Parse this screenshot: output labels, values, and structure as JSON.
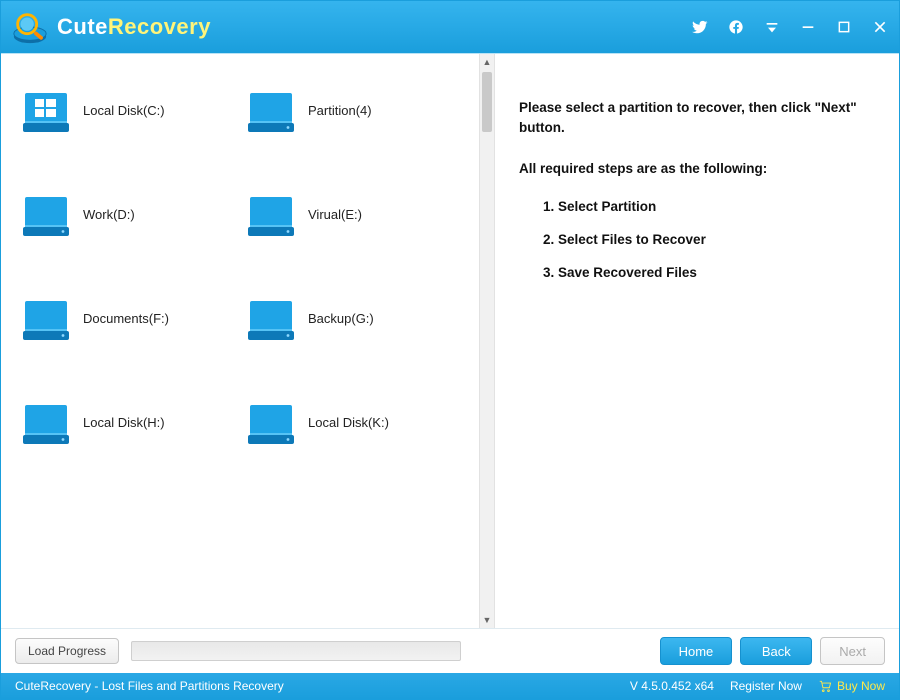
{
  "app": {
    "name_prefix": "Cute",
    "name_suffix": "Recovery"
  },
  "partitions": [
    {
      "label": "Local Disk(C:)",
      "icon": "windows"
    },
    {
      "label": "Partition(4)",
      "icon": "drive"
    },
    {
      "label": "Work(D:)",
      "icon": "drive"
    },
    {
      "label": "Virual(E:)",
      "icon": "drive"
    },
    {
      "label": "Documents(F:)",
      "icon": "drive"
    },
    {
      "label": "Backup(G:)",
      "icon": "drive"
    },
    {
      "label": "Local Disk(H:)",
      "icon": "drive"
    },
    {
      "label": "Local Disk(K:)",
      "icon": "drive"
    }
  ],
  "instructions": {
    "intro": "Please select a partition to recover, then click \"Next\" button.",
    "steps_heading": "All required steps are as the following:",
    "steps": [
      "Select Partition",
      "Select Files to Recover",
      "Save Recovered Files"
    ]
  },
  "buttons": {
    "load_progress": "Load Progress",
    "home": "Home",
    "back": "Back",
    "next": "Next"
  },
  "status": {
    "left": "CuteRecovery - Lost Files and Partitions Recovery",
    "version": "V 4.5.0.452 x64",
    "register": "Register Now",
    "buy": "Buy Now"
  },
  "colors": {
    "accent": "#1a9edc",
    "accent_light": "#35b4ee",
    "highlight": "#ffe84a"
  }
}
